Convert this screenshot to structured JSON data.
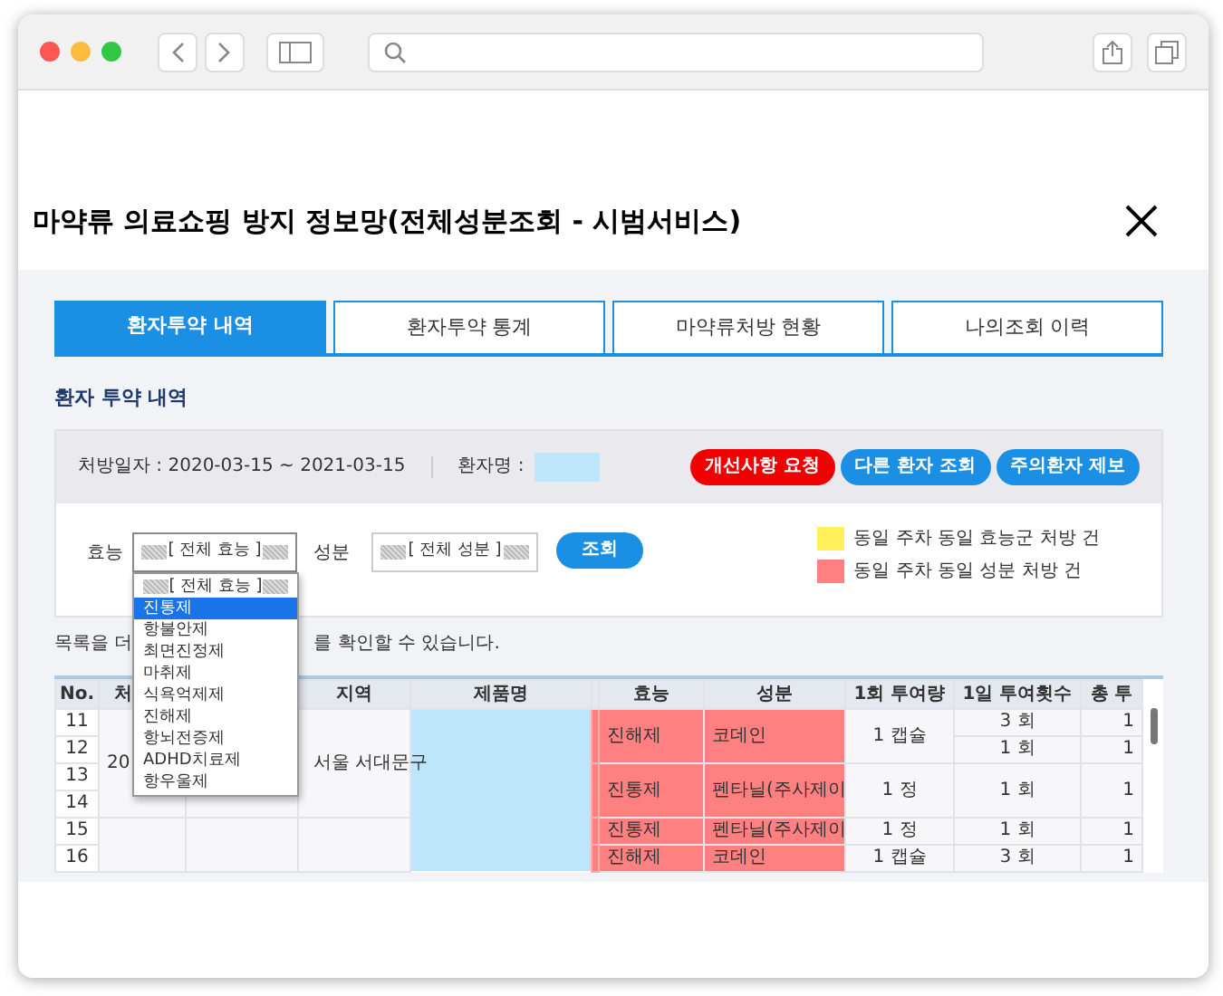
{
  "page": {
    "title": "마약류 의료쇼핑 방지 정보망(전체성분조회 - 시범서비스)"
  },
  "tabs": [
    {
      "label": "환자투약 내역",
      "selected": true
    },
    {
      "label": "환자투약 통계",
      "selected": false
    },
    {
      "label": "마약류처방 현황",
      "selected": false
    },
    {
      "label": "나의조회 이력",
      "selected": false
    }
  ],
  "section_title": "환자 투약 내역",
  "info": {
    "period": "처방일자 : 2020-03-15 ~ 2021-03-15",
    "patient_label": "환자명 :"
  },
  "actions": [
    {
      "label": "개선사항 요청",
      "kind": "danger"
    },
    {
      "label": "다른 환자 조회",
      "kind": "primary"
    },
    {
      "label": "주의환자 제보",
      "kind": "primary"
    }
  ],
  "filters": {
    "efficacy_label": "효능",
    "efficacy_value": "[ 전체 효능 ]",
    "ingredient_label": "성분",
    "ingredient_value": "[ 전체 성분 ]",
    "search_button": "조회"
  },
  "legend": [
    {
      "label": "동일 주차 동일 효능군 처방 건",
      "color": "#ffef5a"
    },
    {
      "label": "동일 주차 동일 성분 처방 건",
      "color": "#ff8080"
    }
  ],
  "notice": {
    "before": "목록을 더",
    "after": "를 확인할 수 있습니다."
  },
  "dropdown": {
    "items": [
      {
        "label": "[ 전체 효능 ]",
        "selected": false
      },
      {
        "label": "진통제",
        "selected": true
      },
      {
        "label": "항불안제",
        "selected": false
      },
      {
        "label": "최면진정제",
        "selected": false
      },
      {
        "label": "마취제",
        "selected": false
      },
      {
        "label": "식욕억제제",
        "selected": false
      },
      {
        "label": "진해제",
        "selected": false
      },
      {
        "label": "항뇌전증제",
        "selected": false
      },
      {
        "label": "ADHD치료제",
        "selected": false
      },
      {
        "label": "항우울제",
        "selected": false
      }
    ]
  },
  "table": {
    "columns": [
      "No.",
      "처",
      "",
      "지역",
      "제품명",
      "효능",
      "성분",
      "1회 투여량",
      "1일 투여횟수",
      "총 투"
    ],
    "groups": [
      {
        "date": "20",
        "region": "서울 서대문구",
        "rows": [
          {
            "no": "11",
            "efficacy": "진해제",
            "ingredient": "코데인",
            "dose": "1 캡슐",
            "times": "3 회",
            "total": "1"
          },
          {
            "no": "12",
            "times": "1 회",
            "total": "1"
          },
          {
            "no": "13",
            "efficacy": "진통제",
            "ingredient": "펜타닐(주사제이",
            "dose": "1 정",
            "times": "1 회",
            "total": "1"
          },
          {
            "no": "14"
          }
        ]
      },
      {
        "rows": [
          {
            "no": "15",
            "efficacy": "진통제",
            "ingredient": "펜타닐(주사제이",
            "dose": "1 정",
            "times": "1 회",
            "total": "1"
          },
          {
            "no": "16",
            "efficacy": "진해제",
            "ingredient": "코데인",
            "dose": "1 캡슐",
            "times": "3 회",
            "total": "1"
          }
        ]
      }
    ]
  }
}
